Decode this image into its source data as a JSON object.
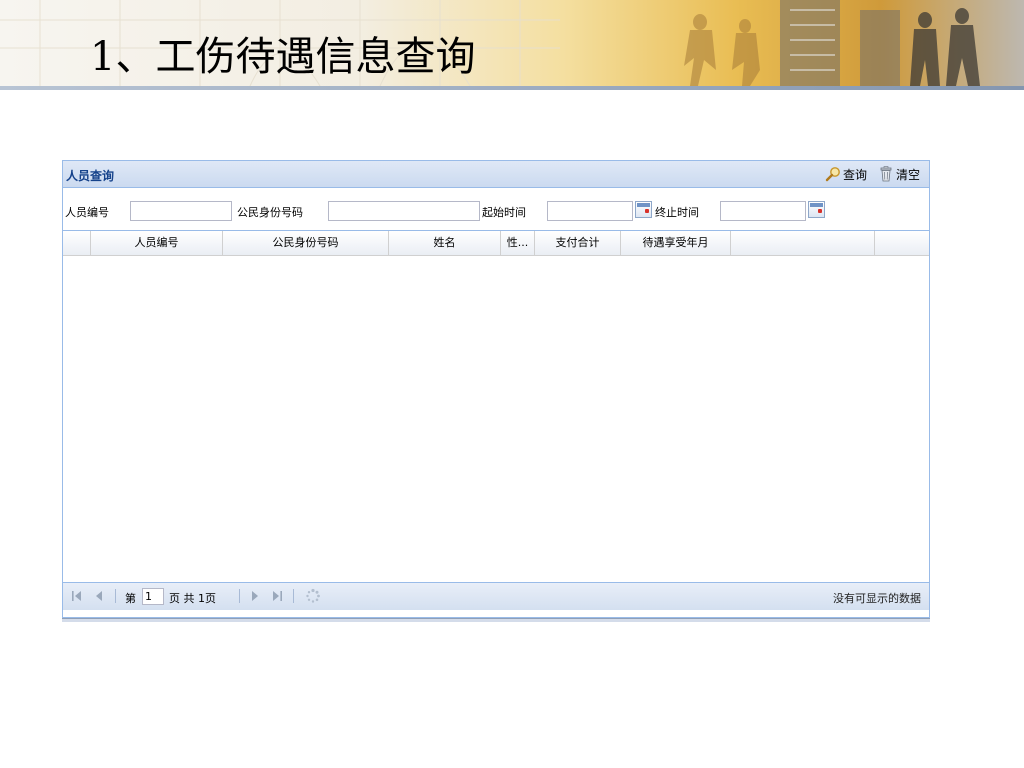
{
  "slide": {
    "title": "1、工伤待遇信息查询"
  },
  "panel": {
    "title": "人员查询",
    "buttons": {
      "search": {
        "label": "查询",
        "icon": "magnifier-icon"
      },
      "clear": {
        "label": "清空",
        "icon": "trash-icon"
      }
    }
  },
  "form": {
    "person_id": {
      "label": "人员编号",
      "value": ""
    },
    "citizen_id": {
      "label": "公民身份号码",
      "value": ""
    },
    "start_time": {
      "label": "起始时间",
      "value": ""
    },
    "end_time": {
      "label": "终止时间",
      "value": ""
    }
  },
  "grid": {
    "columns": [
      "",
      "人员编号",
      "公民身份号码",
      "姓名",
      "性...",
      "支付合计",
      "待遇享受年月",
      ""
    ],
    "rows": []
  },
  "pager": {
    "page_prefix": "第",
    "page_value": "1",
    "page_suffix": "页 共 1页",
    "status": "没有可显示的数据"
  },
  "colors": {
    "panel_border": "#99bbe8",
    "header_bg": "#dfe8f6",
    "title_color": "#15428b"
  }
}
